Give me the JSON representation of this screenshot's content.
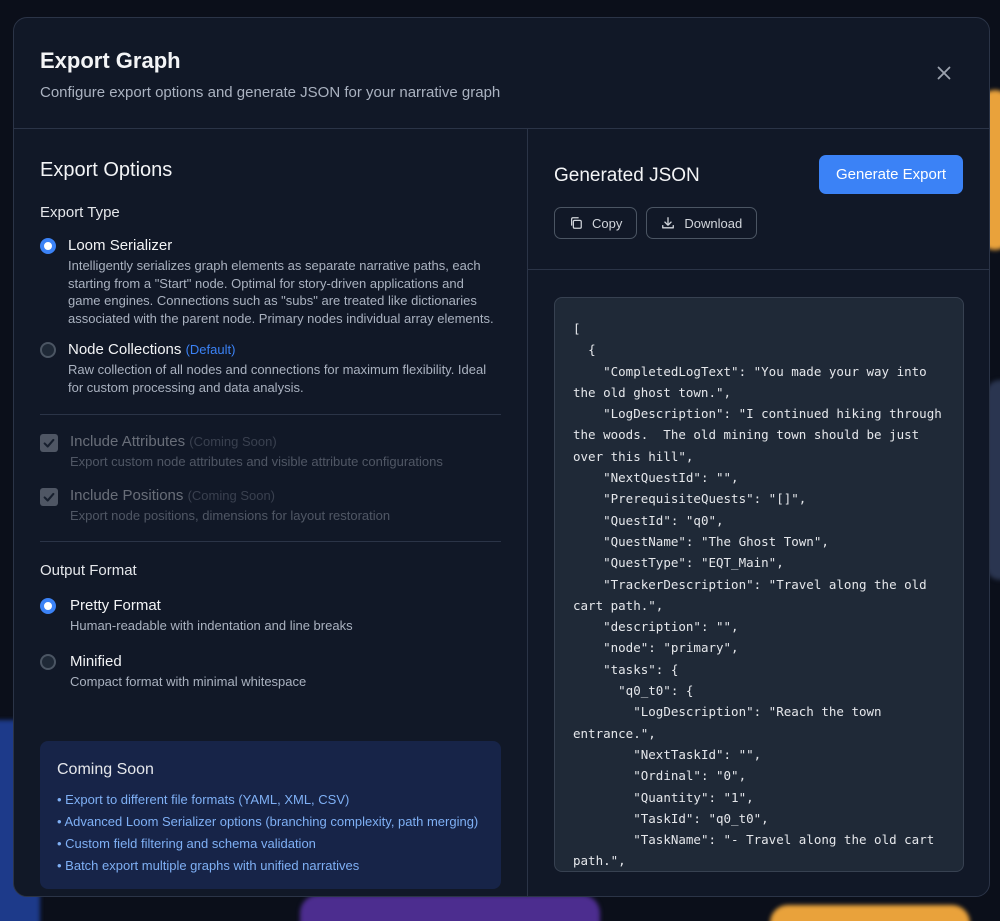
{
  "header": {
    "title": "Export Graph",
    "subtitle": "Configure export options and generate JSON for your narrative graph"
  },
  "options": {
    "title": "Export Options",
    "export_type_label": "Export Type",
    "loom": {
      "title": "Loom Serializer",
      "desc": "Intelligently serializes graph elements as separate narrative paths, each starting from a \"Start\" node. Optimal for story-driven applications and game engines. Connections such as \"subs\" are treated like dictionaries associated with the parent node. Primary nodes individual array elements.",
      "selected": true
    },
    "collections": {
      "title": "Node Collections",
      "tag": "(Default)",
      "desc": "Raw collection of all nodes and connections for maximum flexibility. Ideal for custom processing and data analysis.",
      "selected": false
    },
    "attributes": {
      "title": "Include Attributes",
      "soon": "(Coming Soon)",
      "desc": "Export custom node attributes and visible attribute configurations",
      "checked": true
    },
    "positions": {
      "title": "Include Positions",
      "soon": "(Coming Soon)",
      "desc": "Export node positions, dimensions for layout restoration",
      "checked": true
    },
    "output_label": "Output Format",
    "pretty": {
      "title": "Pretty Format",
      "desc": "Human-readable with indentation and line breaks",
      "selected": true
    },
    "minified": {
      "title": "Minified",
      "desc": "Compact format with minimal whitespace",
      "selected": false
    }
  },
  "coming_soon": {
    "title": "Coming Soon",
    "items": [
      "• Export to different file formats (YAML, XML, CSV)",
      "• Advanced Loom Serializer options (branching complexity, path merging)",
      "• Custom field filtering and schema validation",
      "• Batch export multiple graphs with unified narratives"
    ]
  },
  "json_panel": {
    "title": "Generated JSON",
    "generate_label": "Generate Export",
    "copy_label": "Copy",
    "download_label": "Download",
    "code": "[\n  {\n    \"CompletedLogText\": \"You made your way into the old ghost town.\",\n    \"LogDescription\": \"I continued hiking through the woods.  The old mining town should be just over this hill\",\n    \"NextQuestId\": \"\",\n    \"PrerequisiteQuests\": \"[]\",\n    \"QuestId\": \"q0\",\n    \"QuestName\": \"The Ghost Town\",\n    \"QuestType\": \"EQT_Main\",\n    \"TrackerDescription\": \"Travel along the old cart path.\",\n    \"description\": \"\",\n    \"node\": \"primary\",\n    \"tasks\": {\n      \"q0_t0\": {\n        \"LogDescription\": \"Reach the town entrance.\",\n        \"NextTaskId\": \"\",\n        \"Ordinal\": \"0\",\n        \"Quantity\": \"1\",\n        \"TaskId\": \"q0_t0\",\n        \"TaskName\": \"- Travel along the old cart path.\","
  },
  "colors": {
    "accent": "#3b82f6",
    "panel": "#111827",
    "code_bg": "#1f2937",
    "coming_bg": "#172448"
  }
}
